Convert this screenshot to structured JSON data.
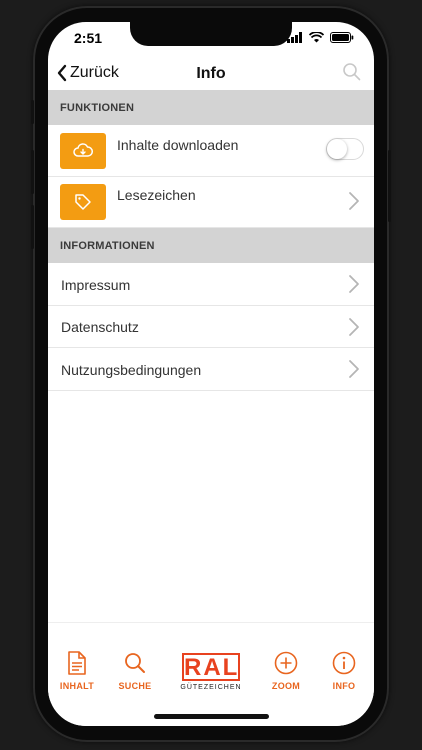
{
  "status_bar": {
    "time": "2:51"
  },
  "navbar": {
    "back_label": "Zurück",
    "title": "Info"
  },
  "sections": {
    "funktionen": {
      "header": "FUNKTIONEN",
      "items": [
        {
          "label": "Inhalte downloaden",
          "icon": "cloud-download-icon",
          "control": "toggle",
          "toggle_on": false
        },
        {
          "label": "Lesezeichen",
          "icon": "tag-icon",
          "control": "chevron"
        }
      ]
    },
    "informationen": {
      "header": "INFORMATIONEN",
      "items": [
        {
          "label": "Impressum"
        },
        {
          "label": "Datenschutz"
        },
        {
          "label": "Nutzungsbedingungen"
        }
      ]
    }
  },
  "tabbar": {
    "inhalt": "INHALT",
    "suche": "SUCHE",
    "logo_text": "RAL",
    "logo_sub": "GÜTEZEICHEN",
    "zoom": "ZOOM",
    "info": "INFO"
  },
  "colors": {
    "accent": "#f39c12",
    "tab_accent": "#e8651f",
    "logo": "#e8421f",
    "section_bg": "#d3d3d3"
  }
}
